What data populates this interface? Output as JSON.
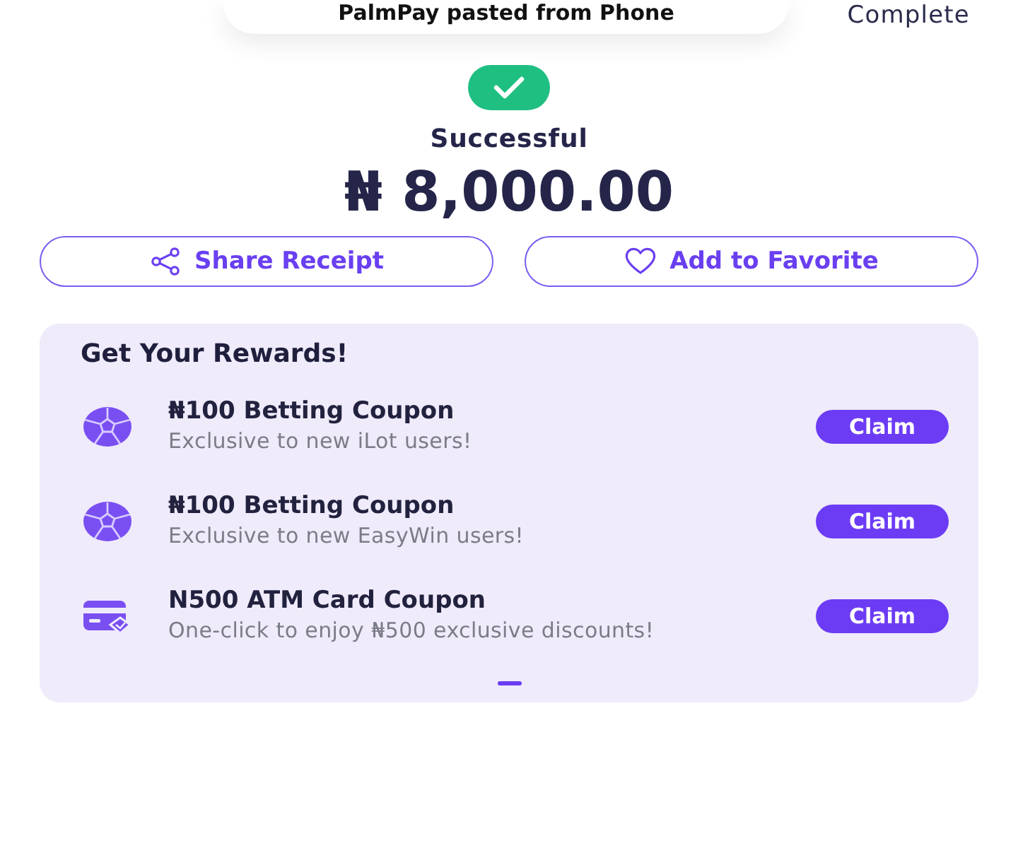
{
  "toast": {
    "text": "PalmPay pasted from Phone"
  },
  "header": {
    "action": "Complete"
  },
  "status": {
    "kind": "success",
    "label": "Successful",
    "amount": "₦ 8,000.00"
  },
  "actions": [
    {
      "kind": "share",
      "label": "Share Receipt"
    },
    {
      "kind": "favorite",
      "label": "Add to Favorite"
    }
  ],
  "rewards": {
    "title": "Get Your Rewards!",
    "items": [
      {
        "kind": "betting",
        "title": "₦100 Betting Coupon",
        "subtitle": "Exclusive to new iLot users!",
        "button": "Claim"
      },
      {
        "kind": "betting",
        "title": "₦100 Betting Coupon",
        "subtitle": "Exclusive to new EasyWin users!",
        "button": "Claim"
      },
      {
        "kind": "card",
        "title": "N500 ATM Card Coupon",
        "subtitle": "One-click to enjoy ₦500 exclusive discounts!",
        "button": "Claim"
      }
    ]
  }
}
